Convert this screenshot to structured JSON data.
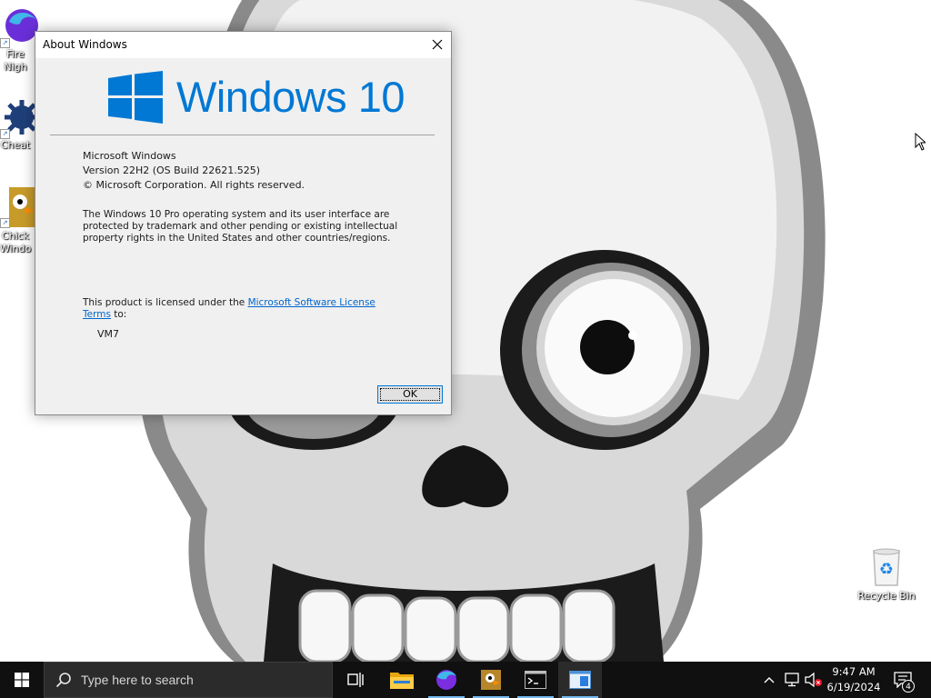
{
  "desktop": {
    "icons": [
      {
        "label": "Fire\nNigh",
        "icon": "firefox-nightly-icon"
      },
      {
        "label": "Cheat",
        "icon": "cheat-engine-icon"
      },
      {
        "label": "Chick\nWindo",
        "icon": "chicken-invaders-icon"
      },
      {
        "label": "Recycle Bin",
        "icon": "recycle-bin-icon"
      }
    ]
  },
  "dialog": {
    "title": "About Windows",
    "brand": "Windows 10",
    "product": "Microsoft Windows",
    "version": "Version 22H2 (OS Build 22621.525)",
    "copyright": "© Microsoft Corporation. All rights reserved.",
    "legal": "The Windows 10 Pro operating system and its user interface are protected by trademark and other pending or existing intellectual property rights in the United States and other countries/regions.",
    "license_prefix": "This product is licensed under the ",
    "license_link_part1": "Microsoft Software License",
    "license_link_part2": "Terms",
    "license_suffix": " to:",
    "licensee": "VM7",
    "ok_label": "OK"
  },
  "taskbar": {
    "search_placeholder": "Type here to search",
    "apps": [
      "task-view-icon",
      "file-explorer-icon",
      "firefox-nightly-icon",
      "chicken-invaders-icon",
      "terminal-icon",
      "winver-icon"
    ],
    "clock_time": "9:47 AM",
    "clock_date": "6/19/2024",
    "notification_count": "4"
  },
  "colors": {
    "accent": "#0078d4",
    "taskbar": "#101010",
    "dialog_bg": "#f0f0f0",
    "link": "#0066cc"
  }
}
